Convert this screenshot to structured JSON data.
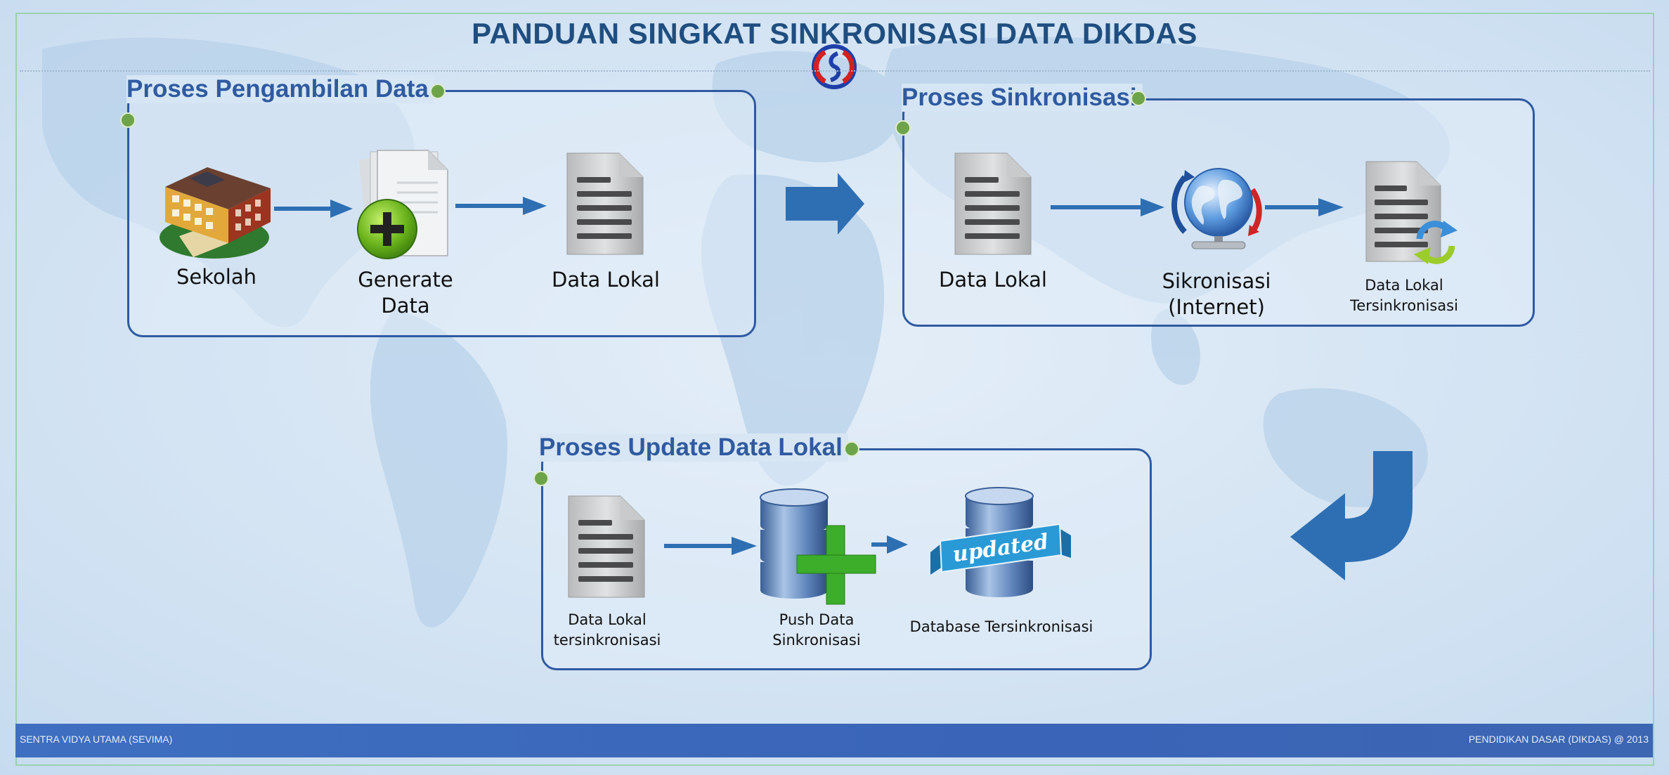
{
  "title": "PANDUAN SINGKAT SINKRONISASI DATA DIKDAS",
  "sections": {
    "pengambilan": {
      "title": "Proses Pengambilan Data",
      "sekolah": "Sekolah",
      "generate_line1": "Generate",
      "generate_line2": "Data",
      "data_lokal": "Data Lokal"
    },
    "sinkronisasi": {
      "title": "Proses Sinkronisasi",
      "data_lokal": "Data Lokal",
      "sikronisasi_line1": "Sikronisasi",
      "sikronisasi_line2": "(Internet)",
      "tersinkron_line1": "Data Lokal",
      "tersinkron_line2": "Tersinkronisasi"
    },
    "update": {
      "title": "Proses Update Data Lokal",
      "data_lokal_line1": "Data Lokal",
      "data_lokal_line2": "tersinkronisasi",
      "push_line1": "Push Data",
      "push_line2": "Sinkronisasi",
      "database": "Database Tersinkronisasi",
      "ribbon_text": "updated"
    }
  },
  "footer": {
    "left": "SENTRA VIDYA UTAMA (SEVIMA)",
    "right": "PENDIDIKAN DASAR (DIKDAS) @ 2013"
  },
  "colors": {
    "accent": "#2f5aa0",
    "title": "#1f4e80",
    "dot": "#6da44a",
    "footer": "#3a64b8"
  }
}
